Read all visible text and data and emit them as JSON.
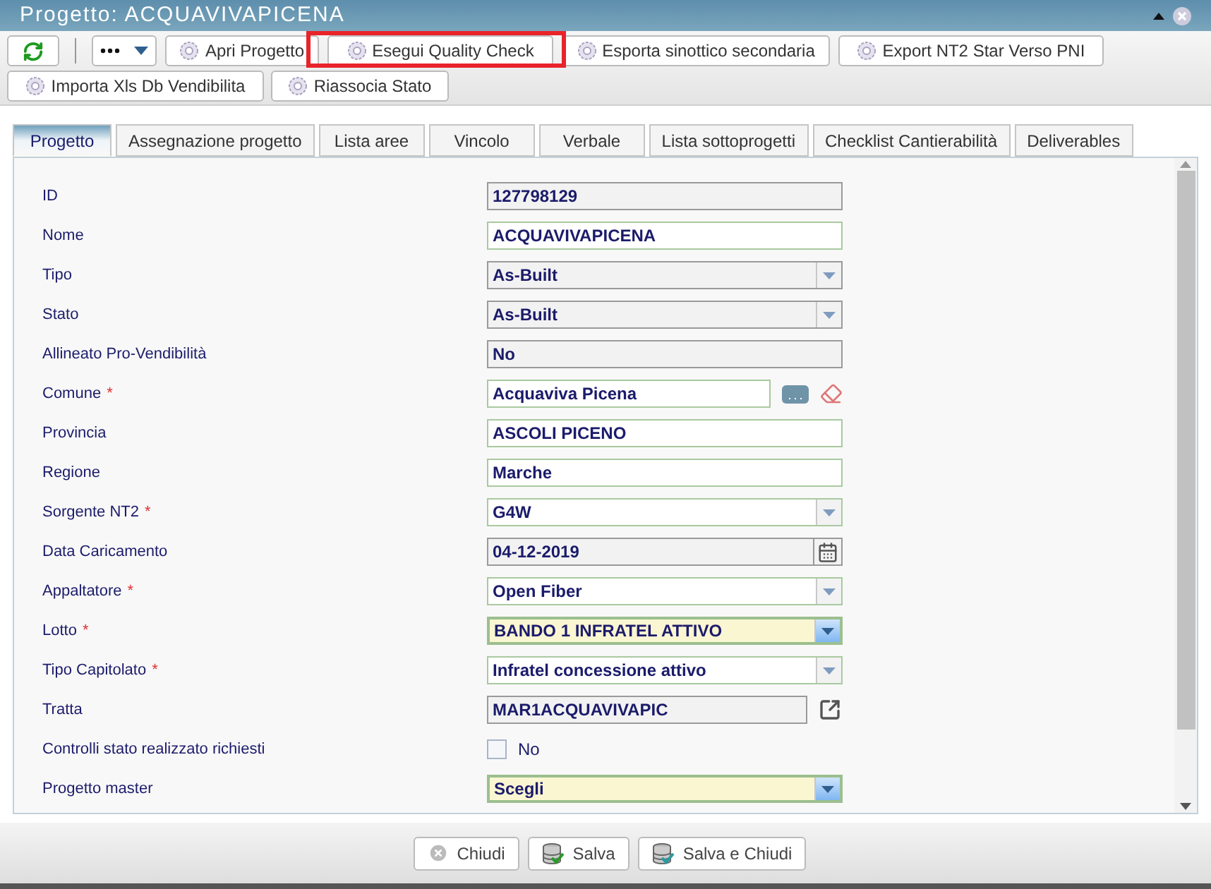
{
  "window": {
    "title": "Progetto: ACQUAVIVAPICENA"
  },
  "toolbar": {
    "buttons": [
      {
        "label": "Apri Progetto"
      },
      {
        "label": "Esegui Quality Check"
      },
      {
        "label": "Esporta sinottico secondaria"
      },
      {
        "label": "Export NT2 Star Verso PNI"
      },
      {
        "label": "Importa Xls Db Vendibilita"
      },
      {
        "label": "Riassocia Stato"
      }
    ]
  },
  "tabs": [
    {
      "label": "Progetto",
      "selected": true
    },
    {
      "label": "Assegnazione progetto",
      "selected": false
    },
    {
      "label": "Lista aree",
      "selected": false
    },
    {
      "label": "Vincolo",
      "selected": false
    },
    {
      "label": "Verbale",
      "selected": false
    },
    {
      "label": "Lista sottoprogetti",
      "selected": false
    },
    {
      "label": "Checklist Cantierabilità",
      "selected": false
    },
    {
      "label": "Deliverables",
      "selected": false
    }
  ],
  "fields": [
    {
      "label": "ID",
      "kind": "readonly",
      "value": "127798129"
    },
    {
      "label": "Nome",
      "kind": "text",
      "value": "ACQUAVIVAPICENA"
    },
    {
      "label": "Tipo",
      "kind": "select",
      "value": "As-Built",
      "readonly": true,
      "highlighted": false
    },
    {
      "label": "Stato",
      "kind": "select",
      "value": "As-Built",
      "readonly": true,
      "highlighted": false
    },
    {
      "label": "Allineato Pro-Vendibilità",
      "kind": "readonly",
      "value": "No"
    },
    {
      "label": "Comune",
      "required_marker": "*",
      "kind": "lookup",
      "value": "Acquaviva Picena"
    },
    {
      "label": "Provincia",
      "kind": "text",
      "value": "ASCOLI PICENO"
    },
    {
      "label": "Regione",
      "kind": "text",
      "value": "Marche"
    },
    {
      "label": "Sorgente NT2",
      "required_marker": "*",
      "kind": "select",
      "value": "G4W",
      "readonly": false,
      "highlighted": false
    },
    {
      "label": "Data Caricamento",
      "kind": "date",
      "value": "04-12-2019"
    },
    {
      "label": "Appaltatore",
      "required_marker": "*",
      "kind": "select",
      "value": "Open Fiber",
      "readonly": false,
      "highlighted": false
    },
    {
      "label": "Lotto",
      "required_marker": "*",
      "kind": "select",
      "value": "BANDO 1 INFRATEL ATTIVO",
      "readonly": false,
      "highlighted": true
    },
    {
      "label": "Tipo Capitolato",
      "required_marker": "*",
      "kind": "select",
      "value": "Infratel concessione attivo",
      "readonly": false,
      "highlighted": false
    },
    {
      "label": "Tratta",
      "kind": "link",
      "value": "MAR1ACQUAVIVAPIC"
    },
    {
      "label": "Controlli stato realizzato richiesti",
      "kind": "checkbox",
      "value": "No",
      "checked": false
    },
    {
      "label": "Progetto master",
      "kind": "select",
      "value": "Scegli",
      "readonly": false,
      "highlighted": true
    }
  ],
  "footer": {
    "buttons": [
      {
        "kind": "close",
        "label": "Chiudi"
      },
      {
        "kind": "save",
        "label": "Salva"
      },
      {
        "kind": "save_close",
        "label": "Salva e Chiudi"
      }
    ]
  }
}
